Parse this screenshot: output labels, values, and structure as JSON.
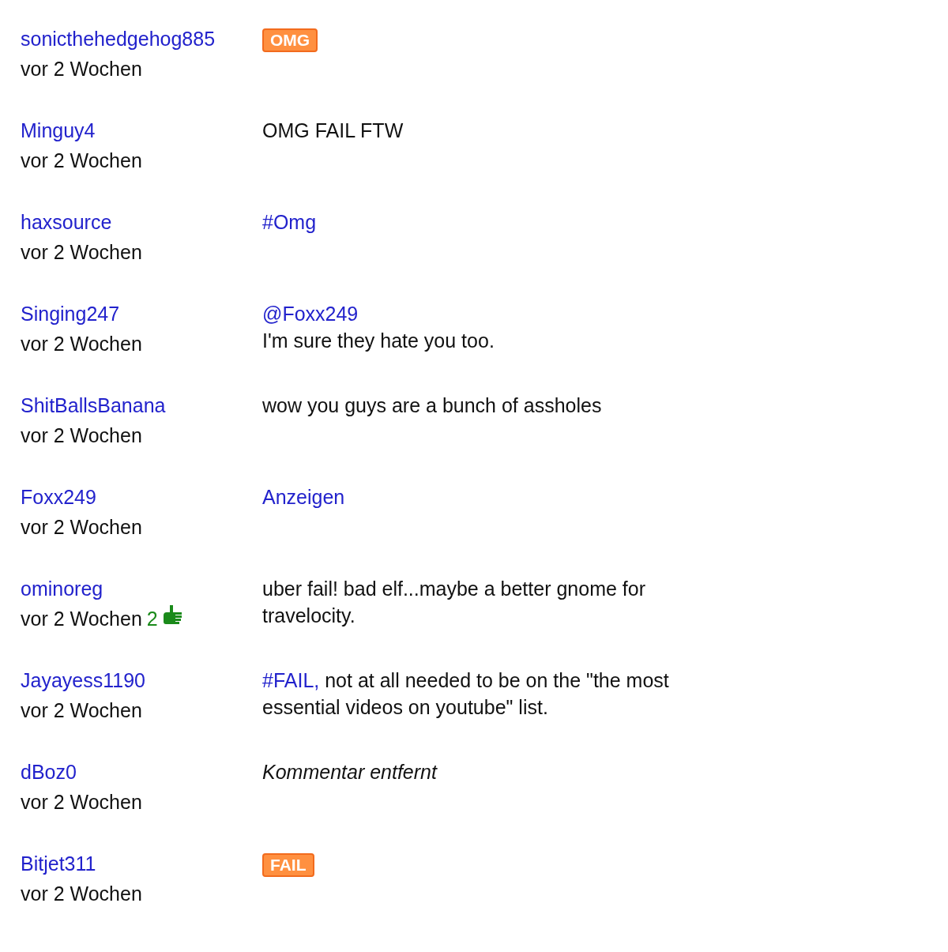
{
  "comments": [
    {
      "user": "sonicthehedgehog885",
      "time": "vor 2 Wochen",
      "lines": [
        [
          {
            "kind": "badge",
            "text": "OMG"
          }
        ]
      ]
    },
    {
      "user": "Minguy4",
      "time": "vor 2 Wochen",
      "lines": [
        [
          {
            "kind": "text",
            "text": "OMG FAIL FTW"
          }
        ]
      ]
    },
    {
      "user": "haxsource",
      "time": "vor 2 Wochen",
      "lines": [
        [
          {
            "kind": "link",
            "text": "#Omg"
          }
        ]
      ]
    },
    {
      "user": "Singing247",
      "time": "vor 2 Wochen",
      "lines": [
        [
          {
            "kind": "link",
            "text": "@Foxx249"
          }
        ],
        [
          {
            "kind": "text",
            "text": "I'm sure they hate you too."
          }
        ]
      ]
    },
    {
      "user": "ShitBallsBanana",
      "time": "vor 2 Wochen",
      "lines": [
        [
          {
            "kind": "text",
            "text": "wow you guys are a bunch of assholes"
          }
        ]
      ]
    },
    {
      "user": "Foxx249",
      "time": "vor 2 Wochen",
      "lines": [
        [
          {
            "kind": "link",
            "text": "Anzeigen"
          }
        ]
      ]
    },
    {
      "user": "ominoreg",
      "time": "vor 2 Wochen",
      "likes": "2",
      "lines": [
        [
          {
            "kind": "text",
            "text": "uber fail! bad elf...maybe a better gnome for travelocity."
          }
        ]
      ]
    },
    {
      "user": "Jayayess1190",
      "time": "vor 2 Wochen",
      "lines": [
        [
          {
            "kind": "link",
            "text": "#FAIL,"
          },
          {
            "kind": "text",
            "text": " not at all needed to be on the \"the most essential videos on youtube\" list."
          }
        ]
      ]
    },
    {
      "user": "dBoz0",
      "time": "vor 2 Wochen",
      "lines": [
        [
          {
            "kind": "removed",
            "text": "Kommentar entfernt"
          }
        ]
      ]
    },
    {
      "user": "Bitjet311",
      "time": "vor 2 Wochen",
      "lines": [
        [
          {
            "kind": "badge",
            "text": "FAIL"
          }
        ]
      ]
    }
  ]
}
